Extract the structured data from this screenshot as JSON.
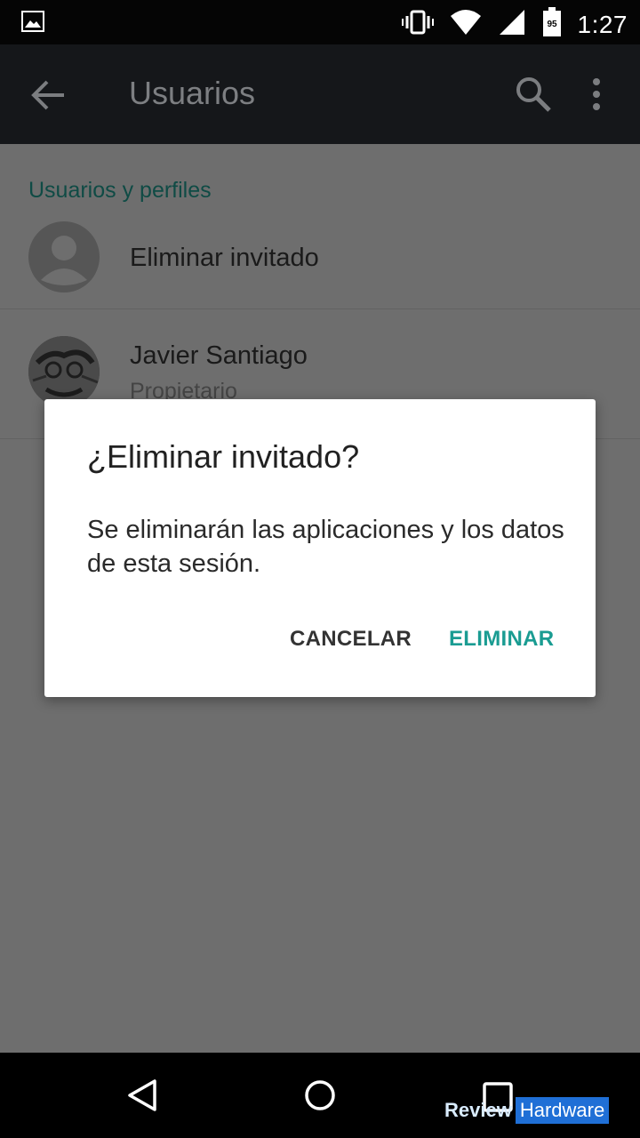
{
  "status_bar": {
    "time": "1:27",
    "battery_level": "95",
    "icons": [
      "image-icon",
      "vibrate-icon",
      "wifi-icon",
      "signal-icon",
      "battery-icon"
    ]
  },
  "toolbar": {
    "title": "Usuarios",
    "icons": [
      "back-arrow-icon",
      "search-icon",
      "more-vert-icon"
    ]
  },
  "content": {
    "section_header": "Usuarios y perfiles",
    "rows": [
      {
        "title": "Eliminar invitado",
        "subtitle": ""
      },
      {
        "title": "Javier Santiago",
        "subtitle": "Propietario"
      }
    ]
  },
  "dialog": {
    "title": "¿Eliminar invitado?",
    "message": "Se eliminarán las aplicaciones y los datos de esta sesión.",
    "cancel_label": "CANCELAR",
    "confirm_label": "ELIMINAR"
  },
  "watermark": {
    "part1": "Review",
    "part2": "Hardware"
  },
  "colors": {
    "accent": "#1a9c92",
    "section_header": "#0f4b45",
    "scrim_background": "#6e6e6e",
    "toolbar": "#15171a"
  }
}
